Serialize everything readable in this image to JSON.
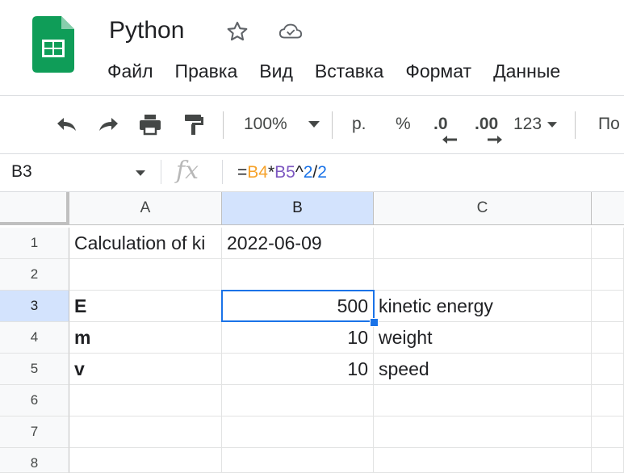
{
  "app": {
    "doc_title": "Python",
    "menu": [
      "Файл",
      "Правка",
      "Вид",
      "Вставка",
      "Формат",
      "Данные"
    ]
  },
  "toolbar": {
    "zoom": "100%",
    "currency": "р.",
    "percent": "%",
    "dec_decrease": ".0",
    "dec_increase": ".00",
    "number_format": "123",
    "font_partial": "По"
  },
  "formula_bar": {
    "name_box": "B3",
    "fx": "fx",
    "formula_parts": {
      "eq": "=",
      "ref1": "B4",
      "op1": "*",
      "ref2": "B5",
      "op2": "^",
      "n1": "2",
      "op3": "/",
      "n2": "2"
    }
  },
  "sheet": {
    "columns": [
      "A",
      "B",
      "C"
    ],
    "rows": [
      "1",
      "2",
      "3",
      "4",
      "5",
      "6",
      "7",
      "8"
    ],
    "cells": {
      "A1": "Calculation of ki",
      "B1": "2022-06-09",
      "A3": "E",
      "B3": "500",
      "C3": "kinetic energy",
      "A4": "m",
      "B4": "10",
      "C4": "weight",
      "A5": "v",
      "B5": "10",
      "C5": "speed"
    },
    "selected_cell": "B3"
  },
  "colors": {
    "accent": "#1a73e8",
    "selected_header": "#d3e3fd",
    "sheets_green": "#0f9d58"
  },
  "icons": [
    "sheets-logo-icon",
    "star-icon",
    "cloud-check-icon",
    "undo-icon",
    "redo-icon",
    "print-icon",
    "paint-format-icon",
    "dropdown-arrow-icon"
  ]
}
